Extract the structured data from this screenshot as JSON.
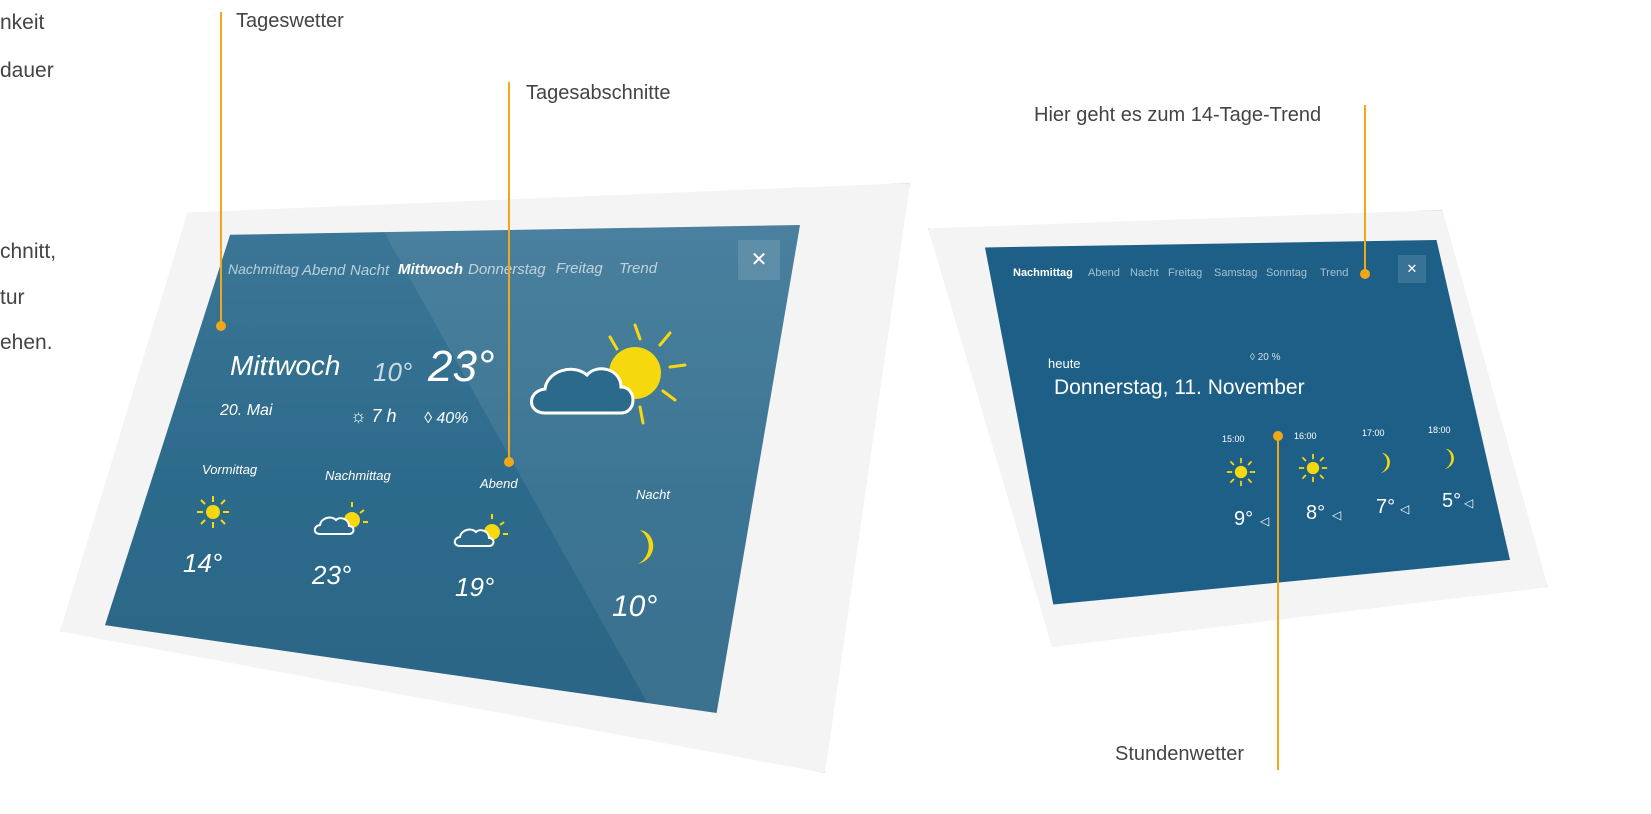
{
  "left_edge_text": [
    "nkeit",
    "dauer",
    "chnitt,",
    "tur",
    "ehen."
  ],
  "annotations": {
    "tageswetter": "Tageswetter",
    "tagesabschnitte": "Tagesabschnitte",
    "trend": "Hier geht es zum 14-Tage-Trend",
    "stundenwetter": "Stundenwetter"
  },
  "left_screen": {
    "tabs": [
      "Nachmittag",
      "Abend",
      "Nacht",
      "Mittwoch",
      "Donnerstag",
      "Freitag",
      "Trend"
    ],
    "active_tab": "Mittwoch",
    "close": "✕",
    "day": "Mittwoch",
    "date": "20. Mai",
    "temp_low": "10°",
    "temp_high": "23°",
    "sun_hours": "☼ 7 h",
    "rain": "◊ 40%",
    "periods": [
      {
        "label": "Vormittag",
        "temp": "14°",
        "icon": "sun-icon"
      },
      {
        "label": "Nachmittag",
        "temp": "23°",
        "icon": "cloud-sun-icon"
      },
      {
        "label": "Abend",
        "temp": "19°",
        "icon": "cloud-sun-icon"
      },
      {
        "label": "Nacht",
        "temp": "10°",
        "icon": "moon-icon"
      }
    ]
  },
  "right_screen": {
    "tabs": [
      "Nachmittag",
      "Abend",
      "Nacht",
      "Freitag",
      "Samstag",
      "Sonntag",
      "Trend"
    ],
    "active_tab": "Nachmittag",
    "close": "✕",
    "label": "heute",
    "rain": "◊ 20 %",
    "date": "Donnerstag, 11. November",
    "hours": [
      {
        "time": "15:00",
        "temp": "9°",
        "icon": "sun-icon"
      },
      {
        "time": "16:00",
        "temp": "8°",
        "icon": "sun-icon"
      },
      {
        "time": "17:00",
        "temp": "7°",
        "icon": "moon-icon"
      },
      {
        "time": "18:00",
        "temp": "5°",
        "icon": "moon-icon"
      }
    ]
  },
  "colors": {
    "accent": "#f0a818",
    "screen": "#2c6a8b",
    "sun": "#f5d90e"
  }
}
